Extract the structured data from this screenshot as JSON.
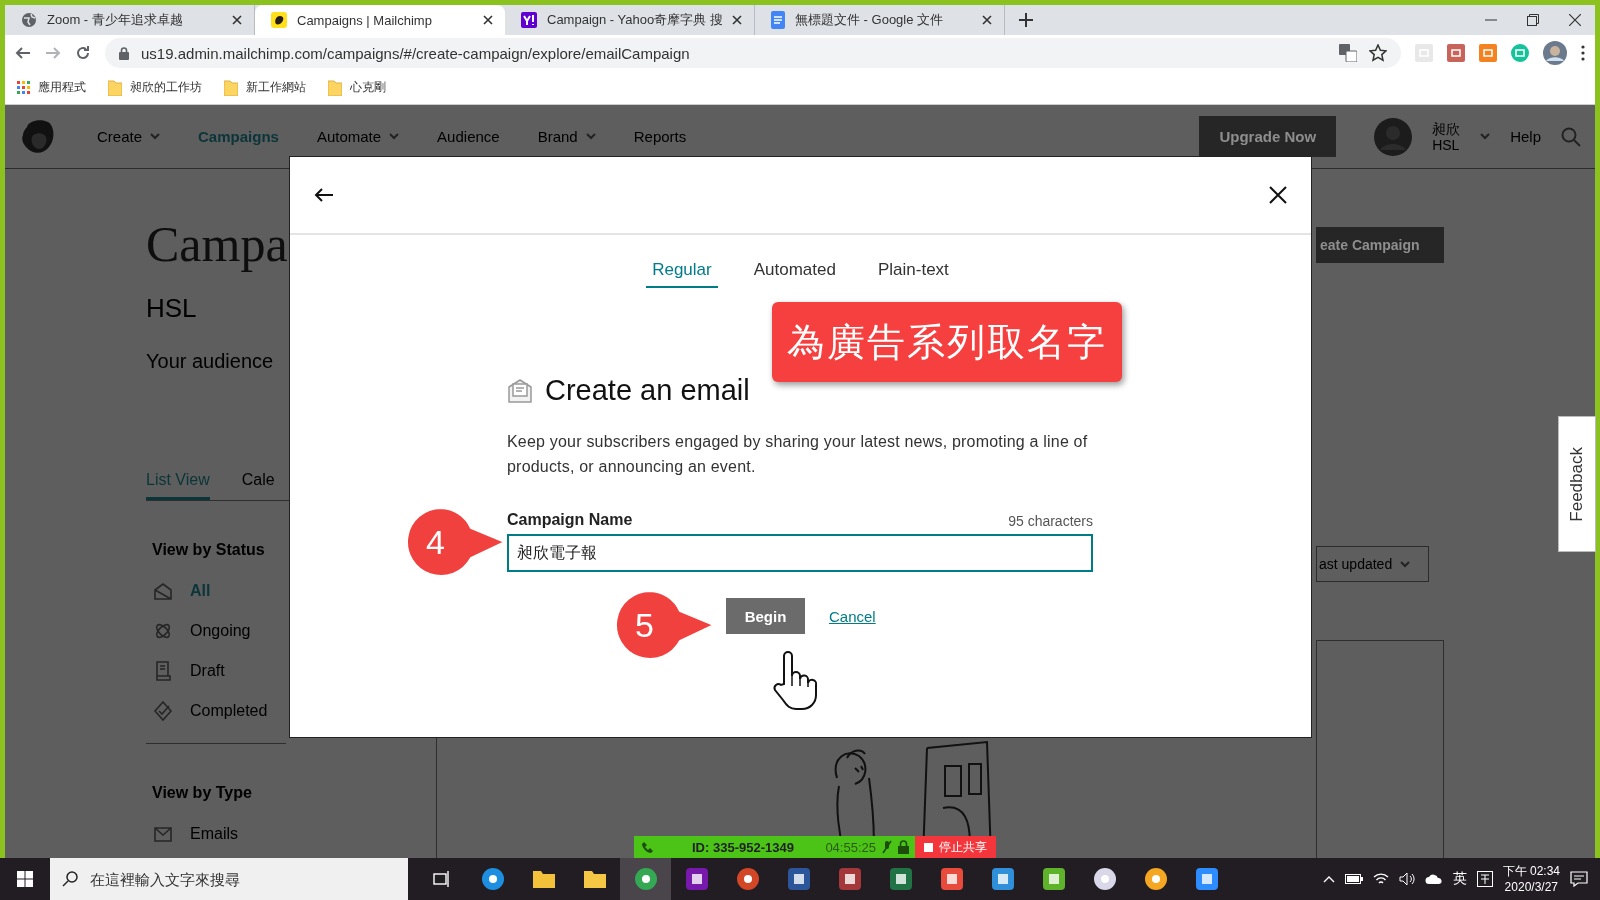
{
  "browser": {
    "tabs": [
      {
        "title": "Zoom - 青少年追求卓越",
        "selected": false,
        "kind": "globe"
      },
      {
        "title": "Campaigns | Mailchimp",
        "selected": true,
        "kind": "mailchimp"
      },
      {
        "title": "Campaign - Yahoo奇摩字典 搜",
        "selected": false,
        "kind": "yahoo"
      },
      {
        "title": "無標題文件 - Google 文件",
        "selected": false,
        "kind": "docs"
      }
    ],
    "url": "us19.admin.mailchimp.com/campaigns/#/create-campaign/explore/emailCampaign",
    "bookmarks": [
      {
        "label": "應用程式",
        "kind": "apps"
      },
      {
        "label": "昶欣的工作坊",
        "kind": "folder"
      },
      {
        "label": "新工作網站",
        "kind": "folder"
      },
      {
        "label": "心克剛",
        "kind": "folder"
      }
    ]
  },
  "app": {
    "nav": [
      {
        "label": "Create",
        "selected": false,
        "dropdown": true
      },
      {
        "label": "Campaigns",
        "selected": true,
        "dropdown": false
      },
      {
        "label": "Automate",
        "selected": false,
        "dropdown": true
      },
      {
        "label": "Audience",
        "selected": false,
        "dropdown": false
      },
      {
        "label": "Brand",
        "selected": false,
        "dropdown": true
      },
      {
        "label": "Reports",
        "selected": false,
        "dropdown": false
      }
    ],
    "upgrade": "Upgrade Now",
    "user": [
      "昶欣",
      "HSL"
    ],
    "help": "Help"
  },
  "page": {
    "title": "Campa",
    "audience": "HSL",
    "intro": "Your audience",
    "view_tabs": [
      {
        "label": "List View",
        "selected": true
      },
      {
        "label": "Cale",
        "selected": false
      }
    ],
    "status_heading": "View by Status",
    "status_items": [
      {
        "label": "All",
        "selected": true,
        "kind": "all"
      },
      {
        "label": "Ongoing",
        "selected": false,
        "kind": "ongoing"
      },
      {
        "label": "Draft",
        "selected": false,
        "kind": "draft"
      },
      {
        "label": "Completed",
        "selected": false,
        "kind": "completed"
      }
    ],
    "type_heading": "View by Type",
    "type_items": [
      {
        "label": "Emails",
        "kind": "email"
      }
    ],
    "create_button": "eate Campaign",
    "sort": "ast updated"
  },
  "modal": {
    "tabs": [
      {
        "label": "Regular",
        "selected": true
      },
      {
        "label": "Automated",
        "selected": false
      },
      {
        "label": "Plain-text",
        "selected": false
      }
    ],
    "heading": "Create an email",
    "description": "Keep your subscribers engaged by sharing your latest news, promoting a line of products, or announcing an event.",
    "field_label": "Campaign Name",
    "counter": "95 characters",
    "value": "昶欣電子報",
    "begin": "Begin",
    "cancel": "Cancel"
  },
  "annotations": {
    "callout": "為廣告系列取名字",
    "steps": [
      "4",
      "5"
    ]
  },
  "feedback": "Feedback",
  "zoom_bar": {
    "meeting_id": "ID: 335-952-1349",
    "elapsed": "04:55:25",
    "stop": "停止共享"
  },
  "taskbar": {
    "search_placeholder": "在這裡輸入文字來搜尋",
    "apps": [
      {
        "kind": "edge",
        "selected": false
      },
      {
        "kind": "folder",
        "selected": false
      },
      {
        "kind": "file",
        "selected": false
      },
      {
        "kind": "chrome",
        "selected": true
      },
      {
        "kind": "purple",
        "selected": false
      },
      {
        "kind": "orange",
        "selected": false
      },
      {
        "kind": "blue",
        "selected": false
      },
      {
        "kind": "crimson",
        "selected": false
      },
      {
        "kind": "green",
        "selected": false
      },
      {
        "kind": "red",
        "selected": false
      },
      {
        "kind": "sky",
        "selected": false
      },
      {
        "kind": "lime",
        "selected": false
      },
      {
        "kind": "parachute",
        "selected": false
      },
      {
        "kind": "shield",
        "selected": false
      },
      {
        "kind": "camera",
        "selected": false
      }
    ],
    "ime": "英",
    "time": "下午 02:34",
    "date": "2020/3/27"
  }
}
